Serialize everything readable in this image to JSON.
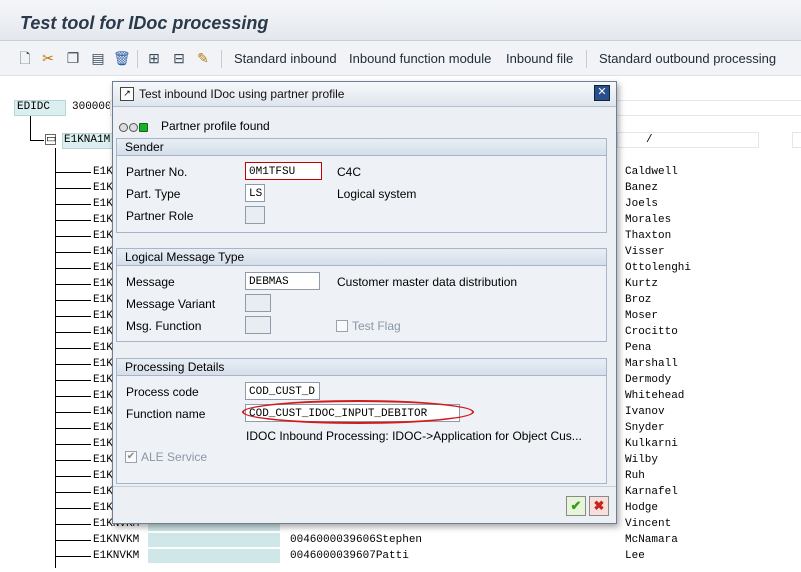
{
  "window": {
    "title": "Test tool for IDoc processing"
  },
  "toolbar": {
    "icons": [
      "new-page-icon",
      "cut-icon",
      "copy-icon",
      "paste-icon",
      "delete-icon",
      "tree-expand-icon",
      "tree-collapse-icon",
      "segment-edit-icon"
    ],
    "buttons": [
      "Standard inbound",
      "Inbound function module",
      "Inbound file",
      "Standard outbound processing"
    ]
  },
  "background": {
    "control_label": "EDIDC",
    "control_value": "300000",
    "root_segment": "E1KNA1M",
    "field_slash": "/",
    "segment_prefix": "E1K",
    "rows": [
      {
        "seg": "E1K",
        "name": "Caldwell"
      },
      {
        "seg": "E1K",
        "name": "Banez"
      },
      {
        "seg": "E1K",
        "name": "Joels"
      },
      {
        "seg": "E1K",
        "name": "Morales"
      },
      {
        "seg": "E1K",
        "name": "Thaxton"
      },
      {
        "seg": "E1K",
        "name": "Visser"
      },
      {
        "seg": "E1K",
        "name": "Ottolenghi"
      },
      {
        "seg": "E1K",
        "name": "Kurtz"
      },
      {
        "seg": "E1K",
        "name": "Broz"
      },
      {
        "seg": "E1K",
        "name": "Moser"
      },
      {
        "seg": "E1K",
        "name": "Crocitto"
      },
      {
        "seg": "E1K",
        "name": "Pena"
      },
      {
        "seg": "E1K",
        "name": "Marshall"
      },
      {
        "seg": "E1K",
        "name": "Dermody"
      },
      {
        "seg": "E1K",
        "name": "Whitehead"
      },
      {
        "seg": "E1K",
        "name": "Ivanov"
      },
      {
        "seg": "E1K",
        "name": "Snyder"
      },
      {
        "seg": "E1K",
        "name": "Kulkarni"
      },
      {
        "seg": "E1K",
        "name": "Wilby"
      },
      {
        "seg": "E1K",
        "name": "Ruh"
      },
      {
        "seg": "E1K",
        "name": "Karnafel"
      },
      {
        "seg": "E1K",
        "name": "Hodge"
      },
      {
        "seg": "E1KNVKM",
        "name": "Vincent"
      },
      {
        "seg": "E1KNVKM",
        "data": "0046000039606Stephen",
        "name": "McNamara"
      },
      {
        "seg": "E1KNVKM",
        "data": "0046000039607Patti",
        "name": "Lee"
      }
    ]
  },
  "dialog": {
    "title": "Test inbound IDoc using partner profile",
    "close_label": "✕",
    "status": "Partner profile found",
    "sender": {
      "title": "Sender",
      "partner_no_label": "Partner No.",
      "partner_no_value": "0M1TFSU",
      "partner_no_desc": "C4C",
      "part_type_label": "Part. Type",
      "part_type_value": "LS",
      "part_type_desc": "Logical system",
      "partner_role_label": "Partner Role"
    },
    "logical_message": {
      "title": "Logical Message Type",
      "message_label": "Message",
      "message_value": "DEBMAS",
      "message_desc": "Customer master data distribution",
      "variant_label": "Message Variant",
      "function_label": "Msg. Function",
      "test_flag_label": "Test Flag"
    },
    "processing": {
      "title": "Processing Details",
      "process_code_label": "Process code",
      "process_code_value": "COD_CUST_D",
      "function_name_label": "Function name",
      "function_name_value": "COD_CUST_IDOC_INPUT_DEBITOR",
      "function_desc": "IDOC Inbound Processing: IDOC->Application for Object Cus...",
      "ale_label": "ALE Service"
    },
    "ok_label": "✔",
    "cancel_label": "✖"
  }
}
